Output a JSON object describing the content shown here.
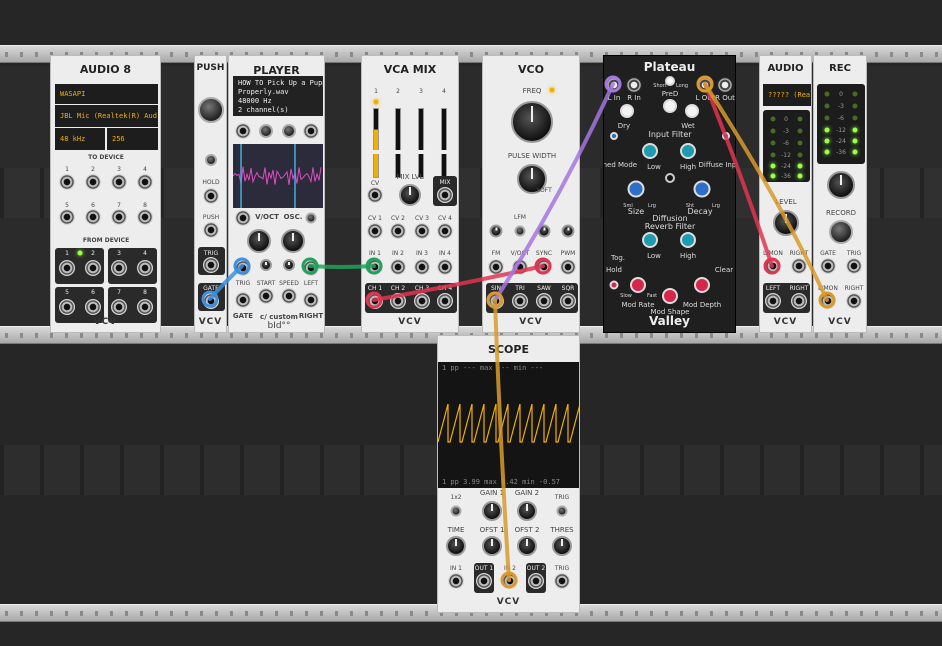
{
  "modules": {
    "audio8": {
      "title": "AUDIO 8",
      "driver": "WASAPI",
      "device": "JBL Mic (Realtek(R) Aud",
      "sample_rate": "48 kHz",
      "block_size": "256",
      "to_device": "TO DEVICE",
      "from_device": "FROM DEVICE",
      "to_labels": [
        "1",
        "2",
        "3",
        "4",
        "5",
        "6",
        "7",
        "8"
      ],
      "from_labels": [
        "1",
        "2",
        "3",
        "4",
        "5",
        "6",
        "7",
        "8"
      ],
      "logo": "VCV"
    },
    "push": {
      "title": "PUSH",
      "hold": "HOLD",
      "push": "PUSH",
      "trig": "TRIG",
      "gate": "GATE",
      "logo": "VCV"
    },
    "player": {
      "title": "PLAYER",
      "info_lines": [
        "HOW TO Pick Up a Puppy",
        "Properly.wav",
        "48000 Hz",
        "2 channel(s)"
      ],
      "voct": "V/OCT",
      "osc": "OSC.",
      "trig": "TRIG",
      "start": "START",
      "speed": "SPEED",
      "left": "LEFT",
      "gate": "GATE",
      "right": "RIGHT",
      "brand": "c/ custom",
      "brand2": "bId°°"
    },
    "vcamix": {
      "title": "VCA MIX",
      "ch_numbers": [
        "1",
        "2",
        "3",
        "4"
      ],
      "mix_lvl": "MIX LVL",
      "cv": "CV",
      "mix": "MIX",
      "cv_labels": [
        "CV 1",
        "CV 2",
        "CV 3",
        "CV 4"
      ],
      "in_labels": [
        "IN 1",
        "IN 2",
        "IN 3",
        "IN 4"
      ],
      "ch_labels": [
        "CH 1",
        "CH 2",
        "CH 3",
        "CH 4"
      ],
      "logo": "VCV"
    },
    "vco": {
      "title": "VCO",
      "freq": "FREQ",
      "pulse_width": "PULSE WIDTH",
      "lfm": "LFM",
      "soft": "SOFT",
      "row_labels": [
        "FM",
        "V/OCT",
        "SYNC",
        "PWM"
      ],
      "out_labels": [
        "SIN",
        "TRI",
        "SAW",
        "SQR"
      ],
      "logo": "VCV"
    },
    "plateau": {
      "title": "Plateau",
      "l_in": "L In",
      "r_in": "R In",
      "pred": "PreD",
      "short": "Short",
      "long": "Long",
      "l_out": "L Out",
      "r_out": "R Out",
      "dry": "Dry",
      "wet": "Wet",
      "input_filter": "Input Filter",
      "tuned_mode": "Tuned Mode",
      "low": "Low",
      "high": "High",
      "diffuse_input": "Diffuse Input",
      "size": "Size",
      "diffusion": "Diffusion",
      "decay": "Decay",
      "sml": "Sml",
      "lrg": "Lrg",
      "sht": "Sht",
      "reverb_filter": "Reverb Filter",
      "tog": "Tog.",
      "hold": "Hold",
      "clear": "Clear",
      "mod_rate": "Mod Rate",
      "mod_shape": "Mod Shape",
      "mod_depth": "Mod Depth",
      "slow": "Slow",
      "fast": "Fast",
      "brand": "Valley"
    },
    "audio": {
      "title": "AUDIO",
      "device": "????? (Real",
      "meter": [
        "0",
        "-3",
        "-6",
        "-12",
        "-24",
        "-36"
      ],
      "level": "LEVEL",
      "lmon": "L/MON",
      "right": "RIGHT",
      "left": "LEFT",
      "logo": "VCV"
    },
    "rec": {
      "title": "REC",
      "meter": [
        "0",
        "-3",
        "-6",
        "-12",
        "-24",
        "-36"
      ],
      "record": "RECORD",
      "gate": "GATE",
      "trig": "TRIG",
      "lmon": "L/MON",
      "right": "RIGHT",
      "logo": "VCV"
    },
    "scope": {
      "title": "SCOPE",
      "top_readout": "1 pp --- max --- min ---",
      "bottom_readout": "1 pp 3.99 max 3.42 min -0.57",
      "labels_row1": [
        "1x2",
        "GAIN 1",
        "GAIN 2",
        "TRIG"
      ],
      "labels_row2": [
        "TIME",
        "OFST 1",
        "OFST 2",
        "THRES"
      ],
      "labels_row3": [
        "IN 1",
        "OUT 1",
        "IN 2",
        "OUT 2",
        "TRIG"
      ],
      "logo": "VCV"
    }
  },
  "colors": {
    "cable_blue": "#3d8fe0",
    "cable_green": "#1fa35b",
    "cable_red": "#e0344f",
    "cable_purple": "#a576e0",
    "cable_orange": "#d89a2a",
    "lcd_text": "#f0b000",
    "scope_trace": "#f0b000"
  }
}
